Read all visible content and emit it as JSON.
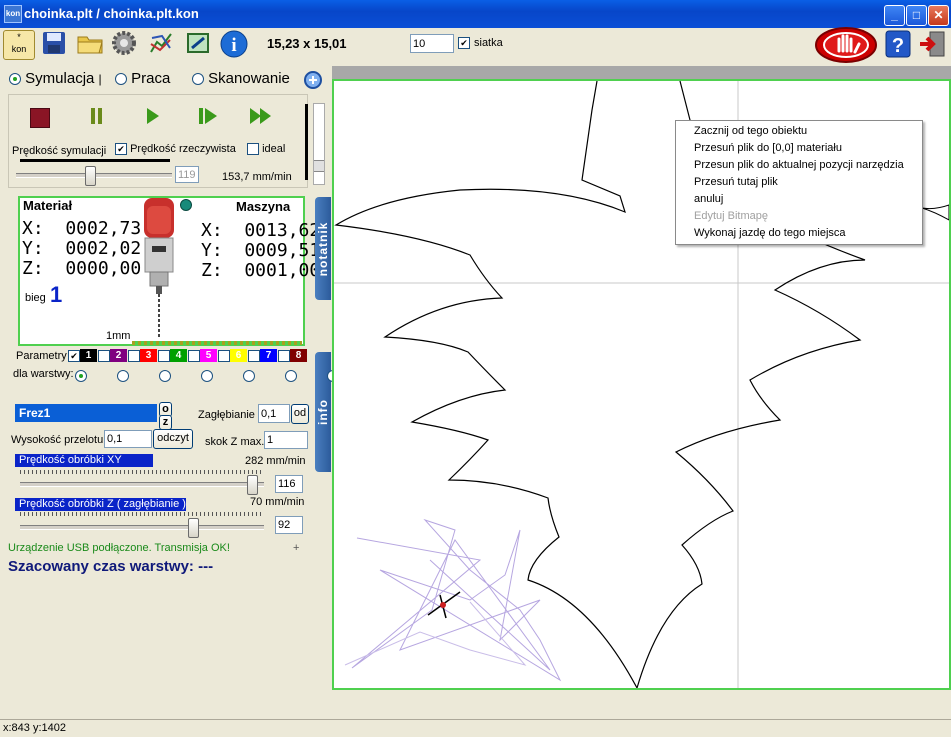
{
  "window": {
    "title": "choinka.plt  /  choinka.plt.kon",
    "app_icon_text": "kon"
  },
  "toolbar": {
    "dimensions": "15,23 x 15,01",
    "grid_value": "10",
    "grid_label": "siatka",
    "grid_checked": true
  },
  "modes": {
    "items": [
      "Symulacja",
      "Praca",
      "Skanowanie"
    ],
    "selected": "Symulacja"
  },
  "simulation": {
    "speed_label": "Prędkość symulacji",
    "real_speed_label": "Prędkość rzeczywista",
    "real_speed_checked": true,
    "ideal_label": "ideal",
    "ideal_checked": false,
    "speed_box": "119",
    "speed_value": "153,7 mm/min",
    "speed_fraction": 0.47
  },
  "positions": {
    "material_title": "Materiał",
    "machine_title": "Maszyna",
    "material": {
      "x": "X:  0002,73",
      "y": "Y:  0002,02",
      "z": "Z:  0000,00"
    },
    "machine": {
      "x": "X:  0013,62",
      "y": "Y:  0009,51",
      "z": "Z:  0001,00"
    },
    "gear_label": "bieg",
    "gear_value": "1",
    "scale_label": "1mm"
  },
  "tabs": {
    "notes": "notatnik",
    "info": "info"
  },
  "parameters": {
    "label": "Parametry",
    "per_layer_label": "dla warstwy:",
    "layers": [
      {
        "n": "1",
        "color": "#000000",
        "checked": true
      },
      {
        "n": "2",
        "color": "#800080",
        "checked": false
      },
      {
        "n": "3",
        "color": "#ff0000",
        "checked": false
      },
      {
        "n": "4",
        "color": "#00a000",
        "checked": false
      },
      {
        "n": "5",
        "color": "#ff00ff",
        "checked": false
      },
      {
        "n": "6",
        "color": "#ffff00",
        "checked": false
      },
      {
        "n": "7",
        "color": "#0000ff",
        "checked": false
      },
      {
        "n": "8",
        "color": "#800000",
        "checked": false
      }
    ]
  },
  "tool": {
    "name": "Frez1",
    "o_label": "o",
    "z_label": "z",
    "depth_label": "Zagłębianie",
    "depth_value": "0,1",
    "depth_button": "od",
    "pass_height_label": "Wysokość przelotu",
    "pass_height_value": "0,1",
    "read_button": "odczyt",
    "z_step_label": "skok Z max.",
    "z_step_value": "1",
    "xy_speed_label": "Prędkość obróbki XY",
    "xy_speed_value": "282 mm/min",
    "xy_speed_box": "116",
    "xy_fraction": 0.97,
    "z_speed_label": "Prędkość obróbki Z  ( zagłębianie )",
    "z_speed_value": "70 mm/min",
    "z_speed_box": "92",
    "z_fraction": 0.72
  },
  "status": {
    "usb": "Urządzenie USB podłączone. Transmisja OK!",
    "plus": "+",
    "estimate": "Szacowany czas warstwy: ---",
    "coords": "x:843   y:1402"
  },
  "context_menu": {
    "items": [
      {
        "label": "Zacznij od tego obiektu",
        "enabled": true
      },
      {
        "label": "Przesuń plik do [0,0] materiału",
        "enabled": true
      },
      {
        "label": "Przesun plik do aktualnej pozycji narzędzia",
        "enabled": true
      },
      {
        "label": "Przesuń tutaj plik",
        "enabled": true
      },
      {
        "label": "anuluj",
        "enabled": true
      },
      {
        "label": "Edytuj Bitmapę",
        "enabled": false
      },
      {
        "label": "Wykonaj jazdę do tego miejsca",
        "enabled": true
      }
    ]
  },
  "colors": {
    "accent_blue": "#0a24c8",
    "frame_green": "#4fd04f",
    "stop_red": "#cc0000"
  }
}
